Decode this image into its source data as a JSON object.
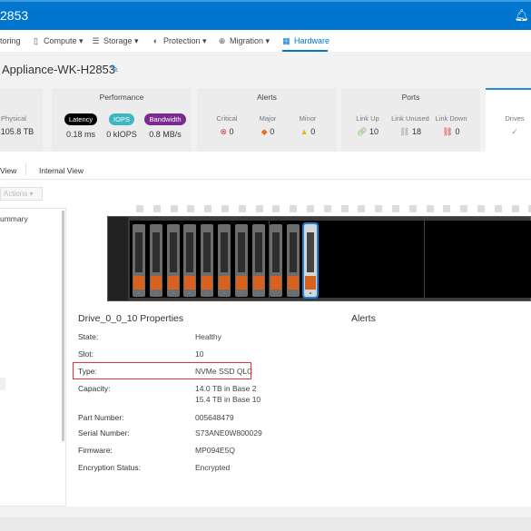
{
  "header": {
    "title": "2853",
    "bell_icon": "bell-icon"
  },
  "nav": {
    "items": [
      {
        "label": "toring",
        "icon": ""
      },
      {
        "label": "Compute ▾",
        "icon": "compute-icon"
      },
      {
        "label": "Storage ▾",
        "icon": "storage-icon"
      },
      {
        "label": "Protection ▾",
        "icon": "shield-icon"
      },
      {
        "label": "Migration ▾",
        "icon": "migration-icon"
      },
      {
        "label": "Hardware",
        "icon": "hardware-icon",
        "active": true
      }
    ]
  },
  "page": {
    "title": "Appliance-WK-H2853"
  },
  "cards": {
    "capacity": {
      "label": "Physical",
      "value": "105.8 TB"
    },
    "performance": {
      "title": "Performance",
      "latency": {
        "label": "Latency",
        "value": "0.18 ms",
        "color": "#000000"
      },
      "iops": {
        "label": "IOPS",
        "value": "0 kIOPS",
        "color": "#3fb6c1"
      },
      "bandwidth": {
        "label": "Bandwidth",
        "value": "0.8 MB/s",
        "color": "#7b2a8f"
      }
    },
    "alerts": {
      "title": "Alerts",
      "critical": {
        "label": "Critical",
        "value": "0"
      },
      "major": {
        "label": "Major",
        "value": "0"
      },
      "minor": {
        "label": "Minor",
        "value": "0"
      }
    },
    "ports": {
      "title": "Ports",
      "link_up": {
        "label": "Link Up",
        "value": "10"
      },
      "link_unused": {
        "label": "Link Unused",
        "value": "18"
      },
      "link_down": {
        "label": "Link Down",
        "value": "0"
      }
    },
    "drives": {
      "label": "Drives",
      "status": "✓"
    }
  },
  "tabs": {
    "front": "View",
    "internal": "Internal View"
  },
  "actions_label": "Actions ▾",
  "left_panel": {
    "item": "ummary"
  },
  "enclosure": {
    "drive_count": 11,
    "selected_slot": 10
  },
  "properties": {
    "title": "Drive_0_0_10 Properties",
    "alerts_title": "Alerts",
    "rows": [
      {
        "label": "State:",
        "value": "Healthy"
      },
      {
        "label": "Slot:",
        "value": "10"
      },
      {
        "label": "Type:",
        "value": "NVMe SSD QLC"
      },
      {
        "label": "Capacity:",
        "value": "14.0 TB in Base 2",
        "value2": "15.4 TB in Base 10"
      },
      {
        "label": "Part Number:",
        "value": "005648479"
      },
      {
        "label": "Serial Number:",
        "value": "S73ANE0W800029"
      },
      {
        "label": "Firmware:",
        "value": "MP094E5Q"
      },
      {
        "label": "Encryption Status:",
        "value": "Encrypted"
      }
    ]
  }
}
